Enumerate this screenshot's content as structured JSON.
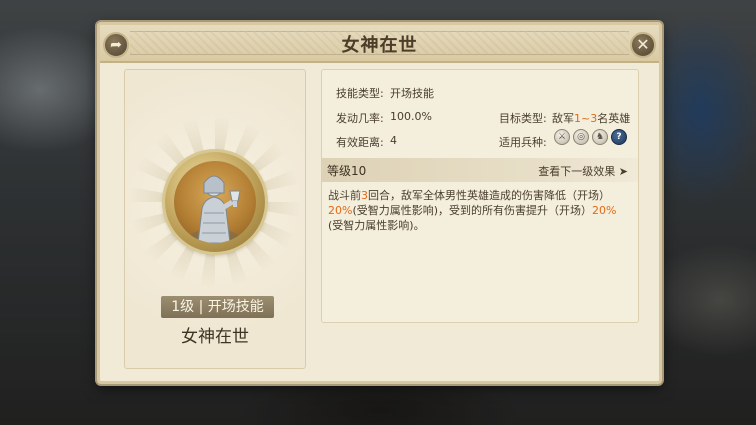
{
  "dialog": {
    "title": "女神在世"
  },
  "skill": {
    "level_tag": "1级 | 开场技能",
    "name": "女神在世"
  },
  "info": {
    "skill_type_label": "技能类型:",
    "skill_type_value": "开场技能",
    "trigger_rate_label": "发动几率:",
    "trigger_rate_value": "100.0%",
    "distance_label": "有效距离:",
    "distance_value": "4",
    "target_type_label": "目标类型:",
    "target_prefix": "敌军",
    "target_count": "1~3",
    "target_suffix": "名英雄",
    "unit_types_label": "适用兵种:",
    "unit_icons": [
      "sword-unit-icon",
      "shield-unit-icon",
      "cavalry-unit-icon",
      "unknown-unit-icon"
    ]
  },
  "level": {
    "label": "等级10",
    "next_link": "查看下一级效果",
    "next_arrow": "➤"
  },
  "description": {
    "part1": "战斗前",
    "rounds": "3",
    "part2": "回合，敌军全体男性英雄造成的伤害降低（开场）",
    "pct1": "20%",
    "part3": "(受智力属性影响)，受到的所有伤害提升（开场）",
    "pct2": "20%",
    "part4": "(受智力属性影响)。"
  },
  "colors": {
    "highlight": "#e26a16",
    "text": "#4a3e2c",
    "panel": "#f1ead7"
  }
}
